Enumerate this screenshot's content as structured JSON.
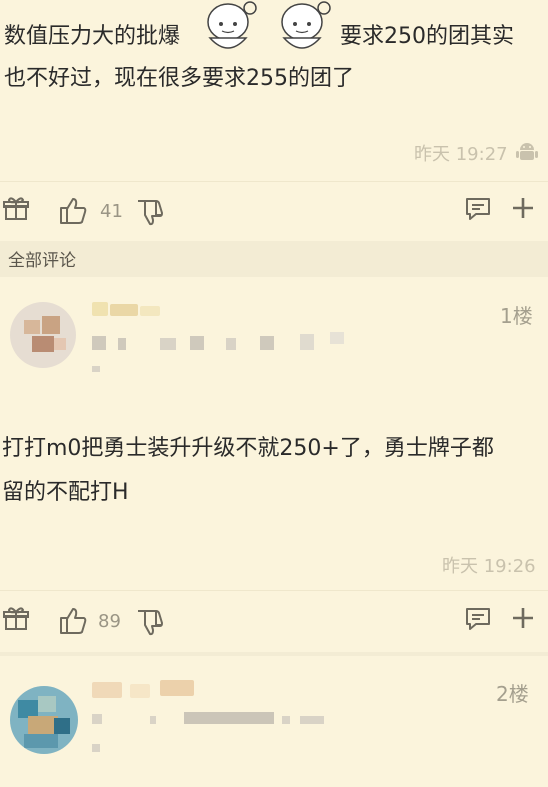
{
  "post": {
    "line1_a": "数值压力大的批爆",
    "line1_b": "要求250的团其实",
    "line2": "也不好过，现在很多要求255的团了",
    "time": "昨天 19:27",
    "like_count": "41",
    "icons": [
      "gift-icon",
      "thumbs-up-icon",
      "thumbs-down-icon",
      "comment-icon",
      "plus-icon",
      "android-icon"
    ]
  },
  "section": {
    "title": "全部评论"
  },
  "comments": [
    {
      "floor": "1楼",
      "line1": "打打m0把勇士装升升级不就250+了，勇士牌子都",
      "line2": "留的不配打H",
      "time": "昨天 19:26",
      "like_count": "89"
    },
    {
      "floor": "2楼"
    }
  ]
}
